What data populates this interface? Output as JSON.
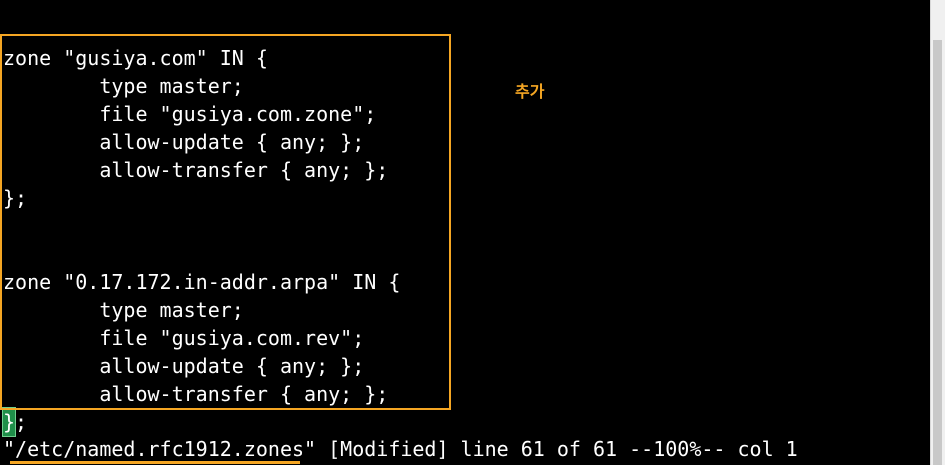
{
  "editor": {
    "lines": [
      "zone \"gusiya.com\" IN {",
      "        type master;",
      "        file \"gusiya.com.zone\";",
      "        allow-update { any; };",
      "        allow-transfer { any; };",
      "};",
      "",
      "",
      "zone \"0.17.172.in-addr.arpa\" IN {",
      "        type master;",
      "        file \"gusiya.com.rev\";",
      "        allow-update { any; };",
      "        allow-transfer { any; };"
    ],
    "cursor_char": "}",
    "cursor_rest": ";"
  },
  "status": {
    "text": "\"/etc/named.rfc1912.zones\" [Modified] line 61 of 61 --100%-- col 1"
  },
  "annotation": {
    "text": "추가",
    "color": "#f5a623"
  },
  "colors": {
    "background": "#000000",
    "text": "#ffffff",
    "highlight": "#f5a623",
    "cursor": "#1f8f4a"
  }
}
